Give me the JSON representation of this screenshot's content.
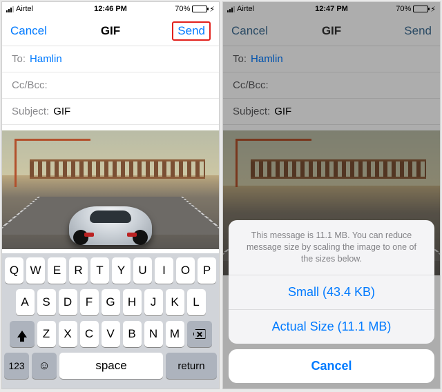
{
  "left": {
    "status": {
      "carrier": "Airtel",
      "time": "12:46 PM",
      "battery_pct": "70%"
    },
    "nav": {
      "cancel": "Cancel",
      "title": "GIF",
      "send": "Send"
    },
    "fields": {
      "to_label": "To:",
      "to_value": "Hamlin",
      "ccbcc_label": "Cc/Bcc:",
      "subject_label": "Subject:",
      "subject_value": "GIF"
    },
    "keyboard": {
      "row1": [
        "Q",
        "W",
        "E",
        "R",
        "T",
        "Y",
        "U",
        "I",
        "O",
        "P"
      ],
      "row2": [
        "A",
        "S",
        "D",
        "F",
        "G",
        "H",
        "J",
        "K",
        "L"
      ],
      "row3": [
        "Z",
        "X",
        "C",
        "V",
        "B",
        "N",
        "M"
      ],
      "num": "123",
      "space": "space",
      "return": "return"
    }
  },
  "right": {
    "status": {
      "carrier": "Airtel",
      "time": "12:47 PM",
      "battery_pct": "70%"
    },
    "nav": {
      "cancel": "Cancel",
      "title": "GIF",
      "send": "Send"
    },
    "fields": {
      "to_label": "To:",
      "to_value": "Hamlin",
      "ccbcc_label": "Cc/Bcc:",
      "subject_label": "Subject:",
      "subject_value": "GIF"
    },
    "sheet": {
      "message": "This message is 11.1 MB. You can reduce message size by scaling the image to one of the sizes below.",
      "option_small": "Small (43.4 KB)",
      "option_actual": "Actual Size (11.1 MB)",
      "cancel": "Cancel"
    }
  }
}
